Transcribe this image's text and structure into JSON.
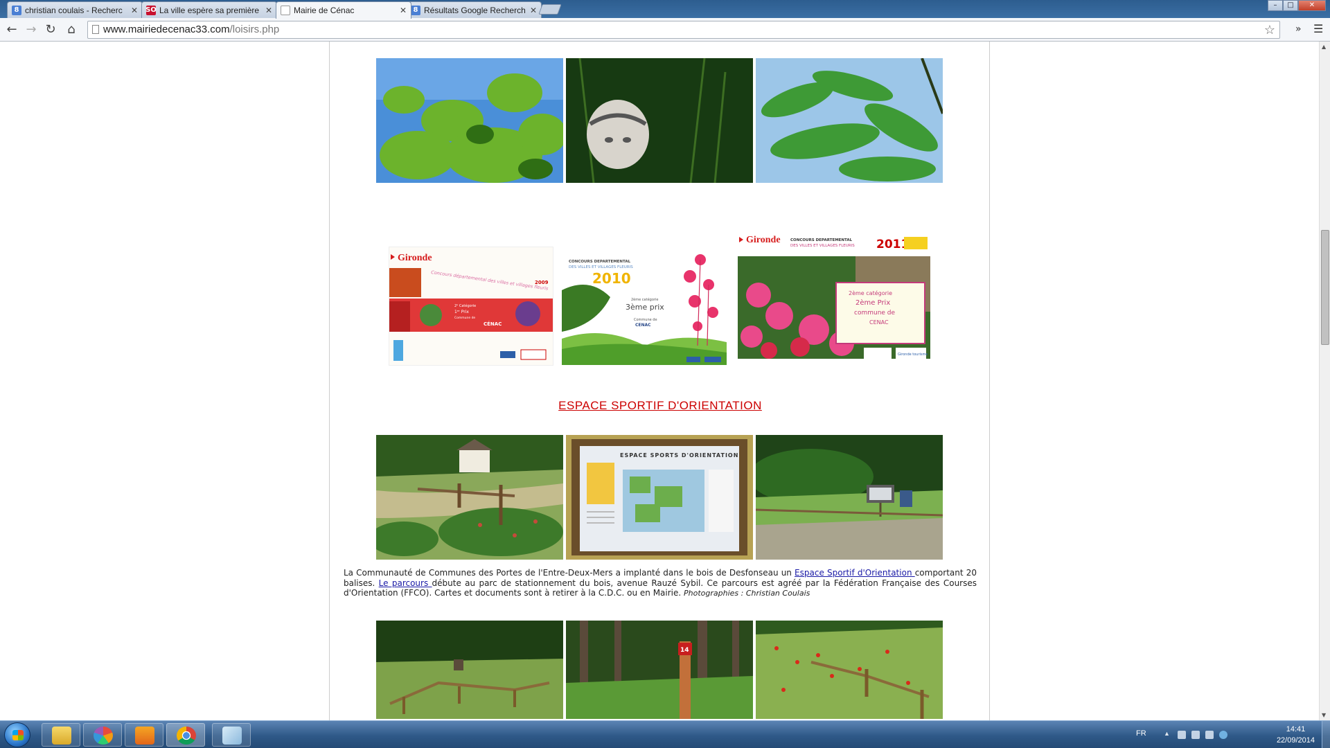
{
  "browser": {
    "tabs": [
      {
        "label": "christian coulais - Recherc",
        "favicon": "google-g-icon"
      },
      {
        "label": "La ville espère sa première",
        "favicon": "sudouest-icon"
      },
      {
        "label": "Mairie de Cénac",
        "favicon": "page-icon"
      },
      {
        "label": "Résultats Google Recherch",
        "favicon": "google-g-icon"
      }
    ],
    "tab_favicon_text": {
      "google": "8",
      "sudouest": "SO"
    },
    "url_host": "www.mairiedecenac33.com",
    "url_path": "/loisirs.php",
    "window_controls": {
      "minimize": "–",
      "maximize": "□",
      "close": "✕"
    }
  },
  "page": {
    "section_title": "ESPACE SPORTIF D'ORIENTATION",
    "paragraph": {
      "p1": "La Communauté de Communes des Portes de l'Entre-Deux-Mers a implanté dans le bois de Desfonseau un ",
      "link1": "Espace Sportif d'Orientation ",
      "p2": "comportant 20 balises. ",
      "link2": "Le parcours ",
      "p3": "débute au parc de stationnement du bois, avenue Rauzé Sybil. Ce parcours est agréé par la Fédération Française des Courses d'Orientation (FFCO). Cartes et documents sont à retirer à la C.D.C. ou en Mairie. ",
      "credit": "Photographies : Christian Coulais"
    },
    "posters": {
      "p2009": {
        "brand": "Gironde",
        "year": "2009",
        "title": "Concours départemental des villes et villages fleuris",
        "cat": "2ᵉ Catégorie",
        "prize": "1ᵉʳ Prix",
        "commune_label": "Commune de",
        "commune": "CÉNAC"
      },
      "p2010": {
        "title_line1": "CONCOURS DEPARTEMENTAL",
        "title_line2": "DES VILLES ET VILLAGES FLEURIS",
        "year": "2010",
        "cat": "2ème catégorie",
        "prize": "3ème prix",
        "commune_label": "Commune de",
        "commune": "CENAC"
      },
      "p2011": {
        "brand": "Gironde",
        "title_line1": "CONCOURS DEPARTEMENTAL",
        "title_line2": "DES VILLES ET VILLAGES FLEURIS",
        "year": "2011",
        "cat": "2ème catégorie",
        "prize": "2ème Prix",
        "commune_line1": "commune de",
        "commune": "CENAC",
        "logo2": "Gironde tourisme"
      }
    },
    "panel_sign": {
      "title": "ESPACE SPORTS D'ORIENTATION"
    },
    "marker_post": {
      "label": "14"
    }
  },
  "taskbar": {
    "lang": "FR",
    "time": "14:41",
    "date": "22/09/2014",
    "pinned": [
      "explorer-folder-icon",
      "picasa-icon",
      "media-player-icon",
      "chrome-icon",
      "notepad-icon"
    ]
  },
  "colors": {
    "section_title": "#cc0000",
    "link": "#1a1aa6",
    "taskbar": "#2f5988"
  }
}
